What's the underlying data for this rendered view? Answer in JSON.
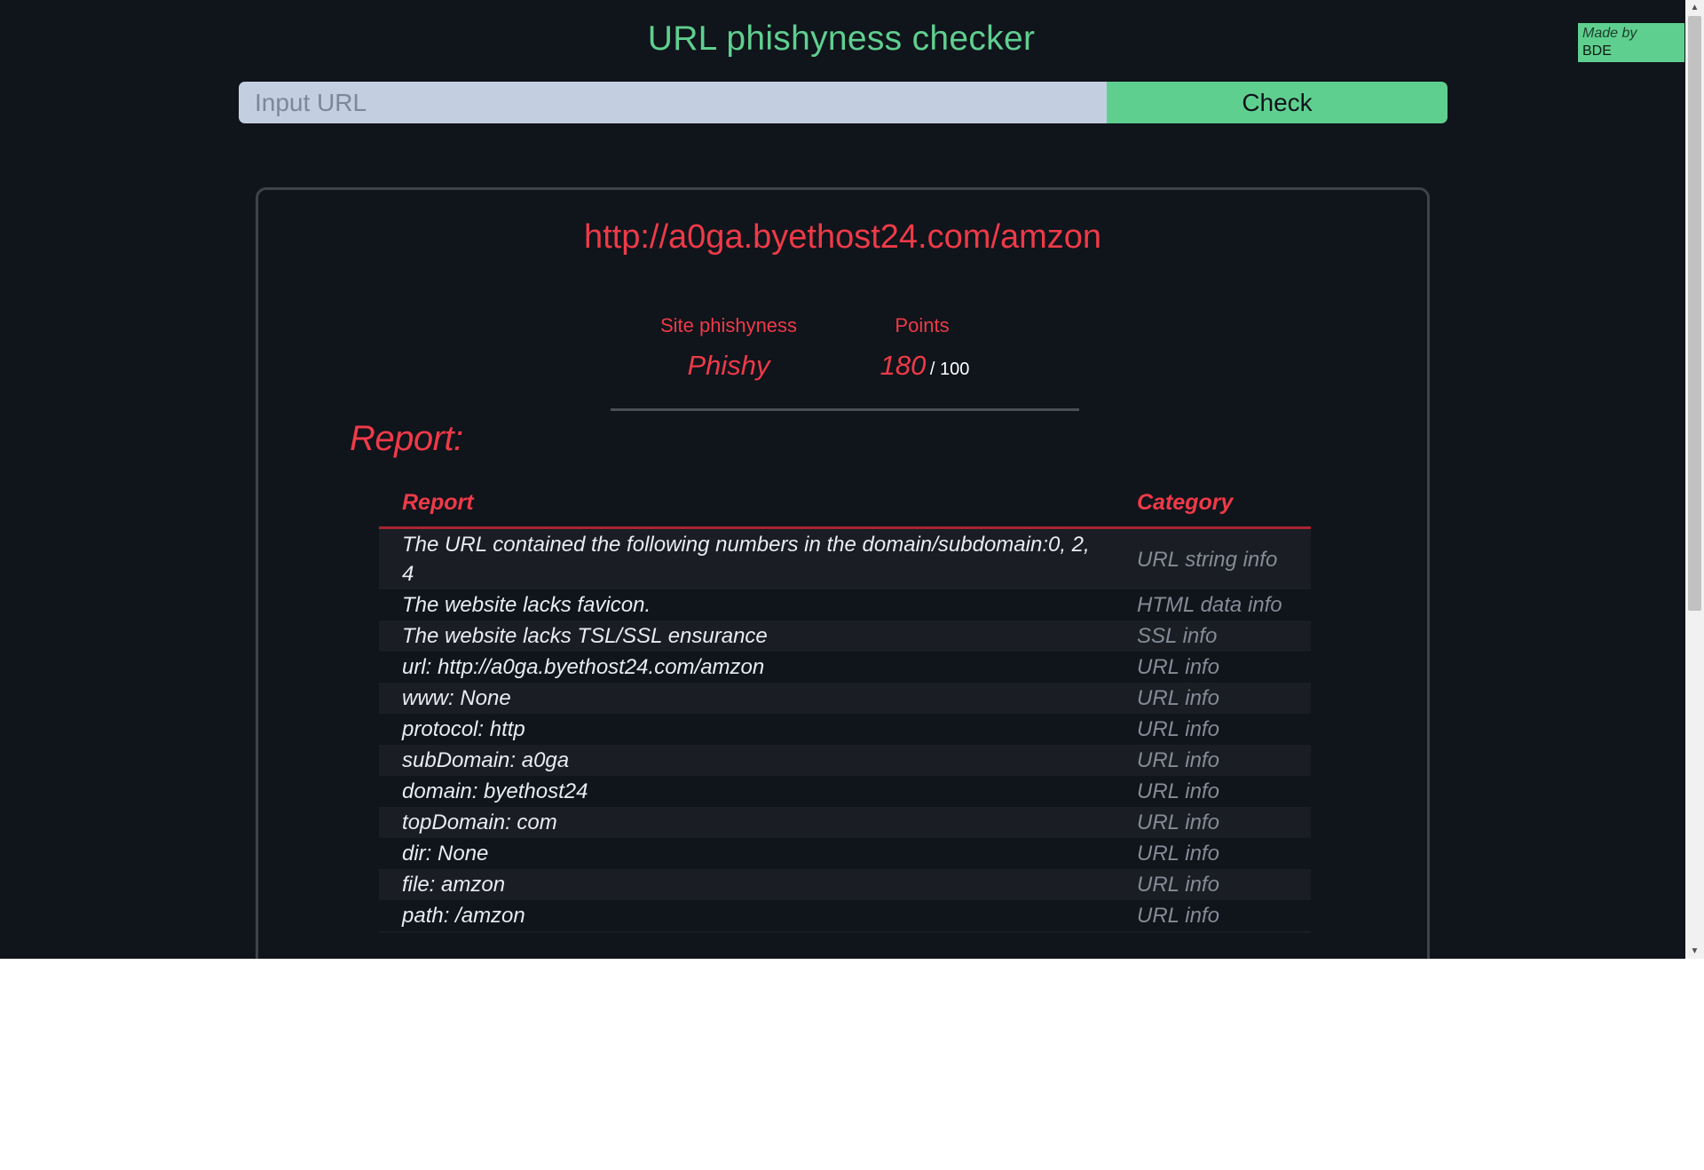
{
  "header": {
    "title": "URL phishyness checker",
    "made_by_label": "Made by",
    "made_by_name": "BDE"
  },
  "search": {
    "placeholder": "Input URL",
    "value": "",
    "button_label": "Check"
  },
  "result": {
    "url": "http://a0ga.byethost24.com/amzon",
    "phishyness_label": "Site phishyness",
    "phishyness_value": "Phishy",
    "points_label": "Points",
    "points_value": "180",
    "points_max": "/ 100",
    "report_heading": "Report:",
    "table": {
      "columns": [
        "Report",
        "Category"
      ],
      "rows": [
        {
          "report": "The URL contained the following numbers in the domain/subdomain:0, 2, 4",
          "category": "URL string info"
        },
        {
          "report": "The website lacks favicon.",
          "category": "HTML data info"
        },
        {
          "report": "The website lacks TSL/SSL ensurance",
          "category": "SSL info"
        },
        {
          "report": "url: http://a0ga.byethost24.com/amzon",
          "category": "URL info"
        },
        {
          "report": "www: None",
          "category": "URL info"
        },
        {
          "report": "protocol: http",
          "category": "URL info"
        },
        {
          "report": "subDomain: a0ga",
          "category": "URL info"
        },
        {
          "report": "domain: byethost24",
          "category": "URL info"
        },
        {
          "report": "topDomain: com",
          "category": "URL info"
        },
        {
          "report": "dir: None",
          "category": "URL info"
        },
        {
          "report": "file: amzon",
          "category": "URL info"
        },
        {
          "report": "path: /amzon",
          "category": "URL info"
        },
        {
          "report": "",
          "category": ""
        }
      ]
    }
  },
  "colors": {
    "background": "#10141b",
    "accent_green": "#5fcf8f",
    "accent_red": "#ee3a48",
    "input_bg": "#c3cfe0"
  }
}
